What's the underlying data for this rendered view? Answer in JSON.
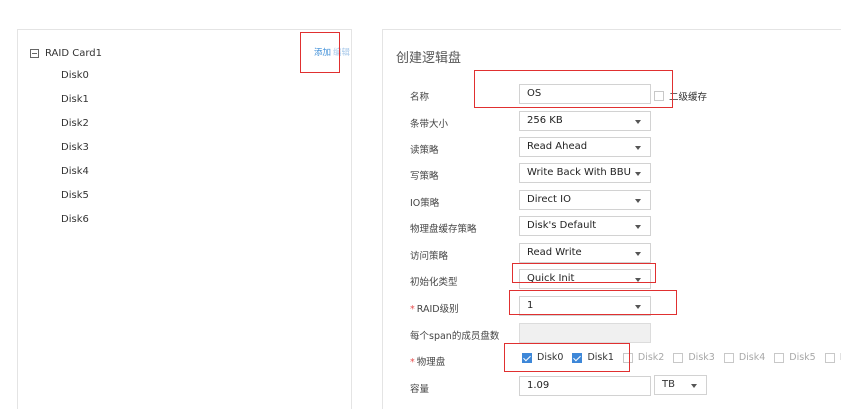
{
  "tree": {
    "root_label": "RAID Card1",
    "actions": {
      "add": "添加",
      "edit": "编辑"
    },
    "children": [
      "Disk0",
      "Disk1",
      "Disk2",
      "Disk3",
      "Disk4",
      "Disk5",
      "Disk6"
    ]
  },
  "form": {
    "title": "创建逻辑盘",
    "fields": {
      "name": {
        "label": "名称",
        "value": "OS"
      },
      "secondary_cache": {
        "label": "二级缓存",
        "checked": false
      },
      "strip_size": {
        "label": "条带大小",
        "value": "256 KB"
      },
      "read_policy": {
        "label": "读策略",
        "value": "Read Ahead"
      },
      "write_policy": {
        "label": "写策略",
        "value": "Write Back With BBU"
      },
      "io_policy": {
        "label": "IO策略",
        "value": "Direct IO"
      },
      "disk_cache_policy": {
        "label": "物理盘缓存策略",
        "value": "Disk's Default"
      },
      "access_policy": {
        "label": "访问策略",
        "value": "Read Write"
      },
      "init_type": {
        "label": "初始化类型",
        "value": "Quick Init"
      },
      "raid_level": {
        "label": "RAID级别",
        "required_mark": "*",
        "value": "1"
      },
      "span_members": {
        "label": "每个span的成员盘数",
        "value": ""
      },
      "physical_disks": {
        "label": "物理盘",
        "required_mark": "*",
        "options": [
          {
            "label": "Disk0",
            "checked": true
          },
          {
            "label": "Disk1",
            "checked": true
          },
          {
            "label": "Disk2",
            "checked": false
          },
          {
            "label": "Disk3",
            "checked": false
          },
          {
            "label": "Disk4",
            "checked": false
          },
          {
            "label": "Disk5",
            "checked": false
          },
          {
            "label": "D",
            "checked": false
          }
        ]
      },
      "capacity": {
        "label": "容量",
        "value": "1.09",
        "unit": "TB"
      }
    }
  },
  "colors": {
    "accent": "#3d87d8",
    "annotation": "#e03030",
    "required": "#e84e4e"
  }
}
